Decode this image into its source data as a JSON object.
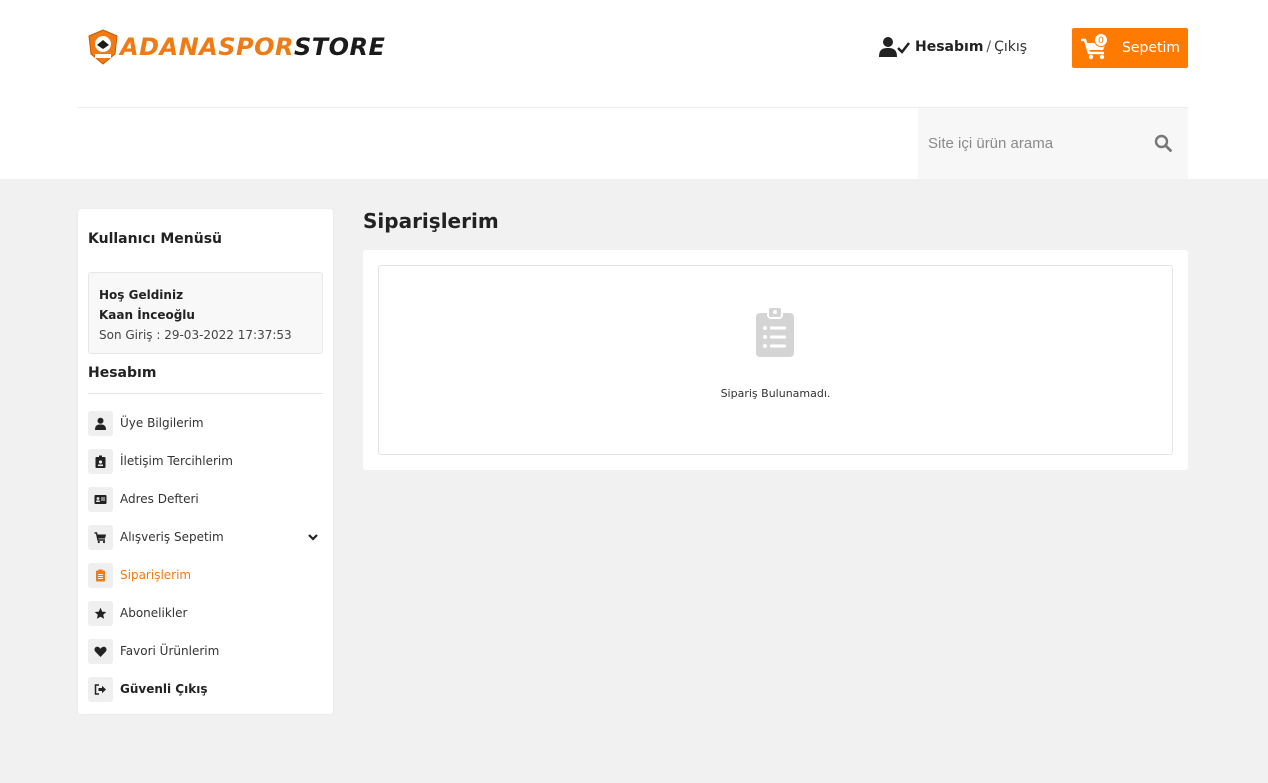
{
  "brand": {
    "part1": "ADANASPOR",
    "part2": "STORE",
    "accent": "#f07a14"
  },
  "header": {
    "account_label": "Hesabım",
    "separator": "/",
    "logout_label": "Çıkış",
    "cart_label": "Sepetim",
    "cart_count": "0",
    "cart_color": "#ff7a00"
  },
  "search": {
    "placeholder": "Site içi ürün arama"
  },
  "sidebar": {
    "title": "Kullanıcı Menüsü",
    "welcome": "Hoş Geldiniz",
    "user_name": "Kaan İnceoğlu",
    "last_login": "Son Giriş : 29-03-2022 17:37:53",
    "section": "Hesabım",
    "items": [
      {
        "label": "Üye Bilgilerim",
        "icon": "user-icon"
      },
      {
        "label": "İletişim Tercihlerim",
        "icon": "id-badge-icon"
      },
      {
        "label": "Adres Defteri",
        "icon": "address-card-icon"
      },
      {
        "label": "Alışveriş Sepetim",
        "icon": "cart-icon"
      },
      {
        "label": "Siparişlerim",
        "icon": "clipboard-icon"
      },
      {
        "label": "Abonelikler",
        "icon": "star-icon"
      },
      {
        "label": "Favori Ürünlerim",
        "icon": "heart-icon"
      },
      {
        "label": "Güvenli Çıkış",
        "icon": "sign-out-icon"
      }
    ]
  },
  "main": {
    "title": "Siparişlerim",
    "empty_message": "Sipariş Bulunamadı."
  }
}
